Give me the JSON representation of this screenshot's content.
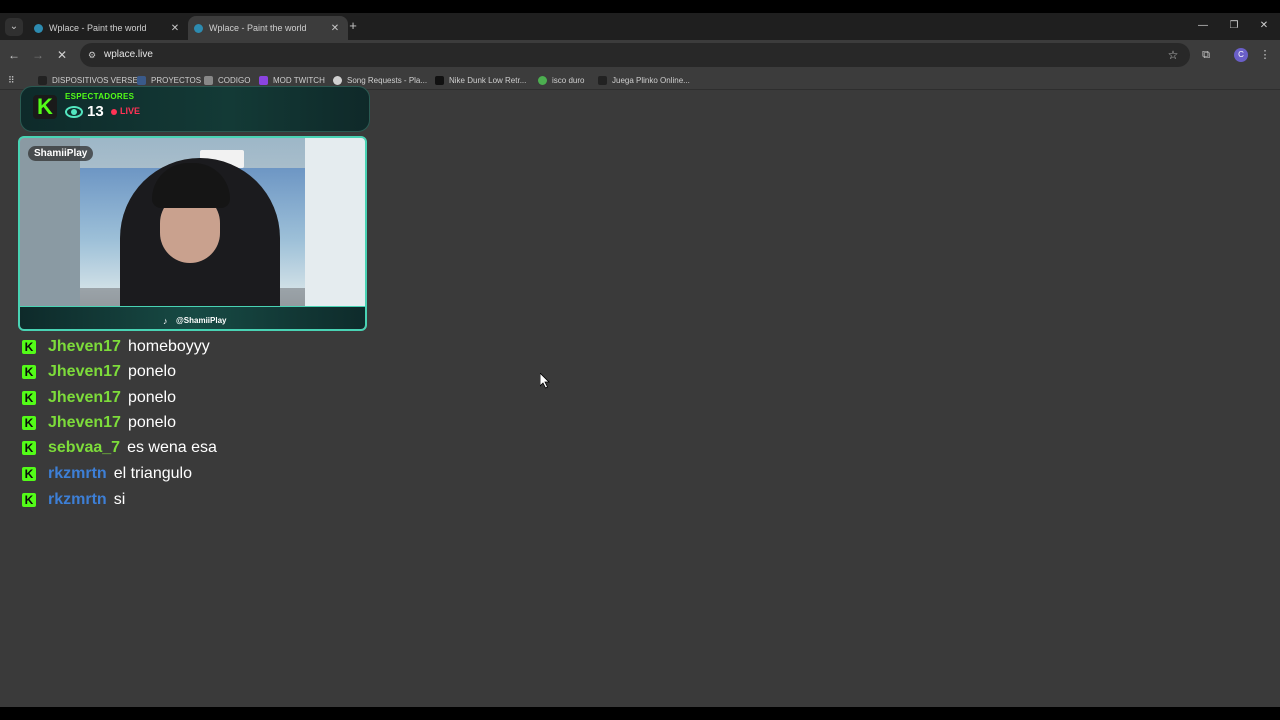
{
  "tabs": [
    {
      "title": "Wplace - Paint the world",
      "active": false
    },
    {
      "title": "Wplace - Paint the world",
      "active": true
    }
  ],
  "address": {
    "url": "wplace.live"
  },
  "profile_initial": "C",
  "bookmarks": [
    {
      "label": "DISPOSITIVOS VERSE",
      "color": "#222222"
    },
    {
      "label": "PROYECTOS",
      "color": "#3a5a8a"
    },
    {
      "label": "CODIGO",
      "color": "#888888"
    },
    {
      "label": "MOD TWITCH",
      "color": "#8a44e0"
    },
    {
      "label": "Song Requests - Pla...",
      "color": "#d0d0d0"
    },
    {
      "label": "Nike Dunk Low Retr...",
      "color": "#111111"
    },
    {
      "label": "isco duro",
      "color": "#4caf50"
    },
    {
      "label": "Juega Plinko Online...",
      "color": "#222222"
    }
  ],
  "overlay": {
    "viewers_label": "ESPECTADORES",
    "viewer_count": "13",
    "live_label": "LIVE",
    "streamer_name": "ShamiiPlay",
    "tiktok_handle": "@ShamiiPlay",
    "accent": "#53fc18"
  },
  "chat": [
    {
      "user": "Jheven17",
      "text": "homeboyyy",
      "color": "#7ddc3a"
    },
    {
      "user": "Jheven17",
      "text": "ponelo",
      "color": "#7ddc3a"
    },
    {
      "user": "Jheven17",
      "text": "ponelo",
      "color": "#7ddc3a"
    },
    {
      "user": "Jheven17",
      "text": "ponelo",
      "color": "#7ddc3a"
    },
    {
      "user": "sebvaa_7",
      "text": "es wena esa",
      "color": "#7ddc3a"
    },
    {
      "user": "rkzmrtn",
      "text": "el triangulo",
      "color": "#3d7fd6"
    },
    {
      "user": "rkzmrtn",
      "text": "si",
      "color": "#3d7fd6"
    }
  ]
}
